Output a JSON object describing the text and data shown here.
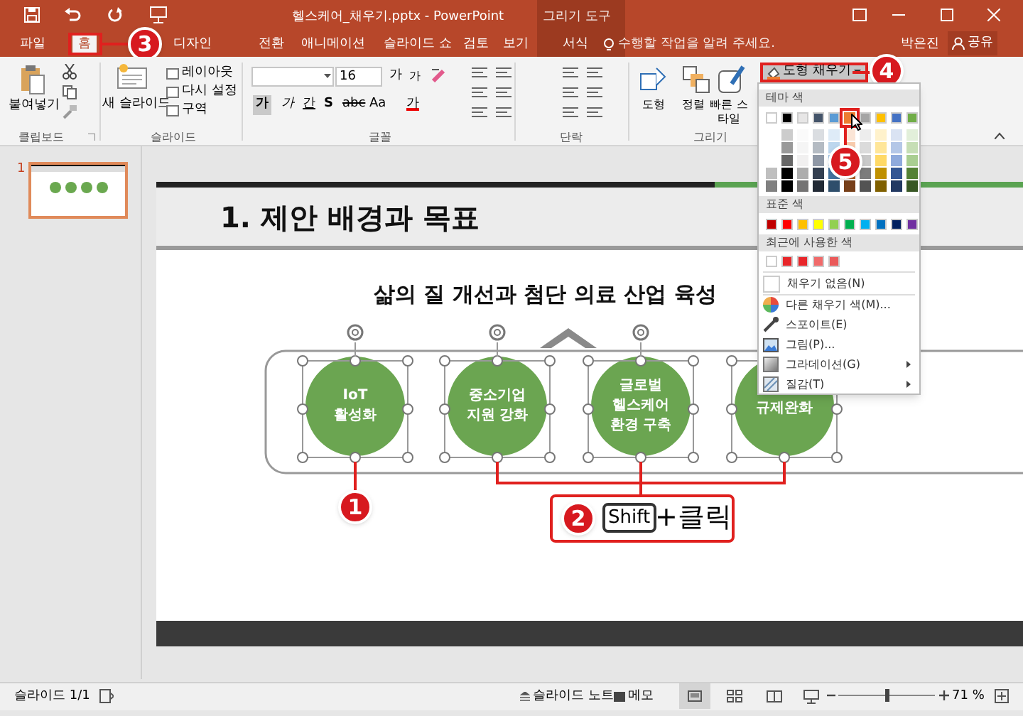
{
  "window": {
    "title": "헬스케어_채우기.pptx - PowerPoint",
    "context_group": "그리기 도구"
  },
  "tabs": [
    {
      "label": "파일",
      "selected": false
    },
    {
      "label": "홈",
      "selected": true
    },
    {
      "label": "디자인",
      "selected": false
    },
    {
      "label": "전환",
      "selected": false
    },
    {
      "label": "애니메이션",
      "selected": false
    },
    {
      "label": "슬라이드 쇼",
      "selected": false
    },
    {
      "label": "검토",
      "selected": false
    },
    {
      "label": "보기",
      "selected": false
    },
    {
      "label": "서식",
      "selected": false
    }
  ],
  "tell_me": {
    "placeholder": "수행할 작업을 알려 주세요."
  },
  "user": "박은진",
  "share": "공유",
  "clipboard": {
    "label": "클립보드",
    "paste": "붙여넣기"
  },
  "slides_group": {
    "label": "슬라이드",
    "new_slide": "새 슬라이드",
    "commands": [
      "레이아웃",
      "다시 설정",
      "구역"
    ]
  },
  "font": {
    "label": "글꼴",
    "size": "16",
    "grow": "가",
    "shrink": "가",
    "format": [
      {
        "label": "가",
        "kind": "bold"
      },
      {
        "label": "가",
        "kind": "italic"
      },
      {
        "label": "간",
        "kind": "underline"
      },
      {
        "label": "S",
        "kind": "shadow"
      },
      {
        "label": "abc",
        "kind": "strike"
      },
      {
        "label": "Aa",
        "kind": "case"
      },
      {
        "label": "가",
        "kind": "color"
      }
    ]
  },
  "paragraph": {
    "label": "단락"
  },
  "drawing": {
    "label": "그리기",
    "buttons": [
      "도형",
      "정렬",
      "빠른 스타일"
    ]
  },
  "shape_fill": {
    "label": "도형 채우기",
    "expanded": true
  },
  "fill_menu": {
    "theme_header": "테마 색",
    "theme_colors": [
      {
        "color": "#ffffff",
        "selected": false
      },
      {
        "color": "#000000",
        "selected": false
      },
      {
        "color": "#e7e6e6",
        "selected": false
      },
      {
        "color": "#44546a",
        "selected": false
      },
      {
        "color": "#5b9bd5",
        "selected": false
      },
      {
        "color": "#ed7d31",
        "selected": true
      },
      {
        "color": "#a5a5a5",
        "selected": false
      },
      {
        "color": "#ffc000",
        "selected": false
      },
      {
        "color": "#4472c4",
        "selected": false
      },
      {
        "color": "#70ad47",
        "selected": false
      }
    ],
    "standard_header": "표준 색",
    "standard_colors": [
      {
        "color": "#c00000"
      },
      {
        "color": "#ff0000"
      },
      {
        "color": "#ffc000"
      },
      {
        "color": "#ffff00"
      },
      {
        "color": "#92d050"
      },
      {
        "color": "#00b050"
      },
      {
        "color": "#00b0f0"
      },
      {
        "color": "#0070c0"
      },
      {
        "color": "#002060"
      },
      {
        "color": "#7030a0"
      }
    ],
    "recent_header": "최근에 사용한 색",
    "recent_colors": [
      {
        "color": "#ffffff"
      },
      {
        "color": "#e8262a"
      },
      {
        "color": "#e8262a"
      },
      {
        "color": "#f06a6a"
      },
      {
        "color": "#ea5a5a"
      }
    ],
    "items": [
      {
        "label": "채우기 없음(N)",
        "kind": "none",
        "submenu": false
      },
      {
        "label": "다른 채우기 색(M)...",
        "kind": "more",
        "submenu": false
      },
      {
        "label": "스포이트(E)",
        "kind": "eyedropper",
        "submenu": false
      },
      {
        "label": "그림(P)...",
        "kind": "picture",
        "submenu": false
      },
      {
        "label": "그라데이션(G)",
        "kind": "gradient",
        "submenu": true
      },
      {
        "label": "질감(T)",
        "kind": "texture",
        "submenu": true
      }
    ]
  },
  "slide_pane": [
    {
      "number": "1",
      "selected": true
    }
  ],
  "slide": {
    "title": "1. 제안 배경과 목표",
    "subtitle": "삶의 질 개선과 첨단 의료 산업 육성",
    "circles": [
      {
        "lines": [
          "IoT",
          "활성화"
        ],
        "selected": true
      },
      {
        "lines": [
          "중소기업",
          "지원 강화"
        ],
        "selected": true
      },
      {
        "lines": [
          "글로벌",
          "헬스케어",
          "환경 구축"
        ],
        "selected": true
      },
      {
        "lines": [
          "규제완화"
        ],
        "selected": true
      }
    ]
  },
  "callouts": [
    {
      "number": "1"
    },
    {
      "number": "2",
      "key": "Shift",
      "text": "+클릭"
    },
    {
      "number": "3"
    },
    {
      "number": "4"
    },
    {
      "number": "5"
    }
  ],
  "status_bar": {
    "slide": "슬라이드 1/1",
    "notes": "슬라이드 노트",
    "comments": "메모",
    "views": [
      {
        "kind": "normal",
        "selected": true
      },
      {
        "kind": "sorter",
        "selected": false
      },
      {
        "kind": "reading",
        "selected": false
      },
      {
        "kind": "show",
        "selected": false
      }
    ],
    "zoom": {
      "level": 0.5
    },
    "zoom_text": "71 %"
  }
}
